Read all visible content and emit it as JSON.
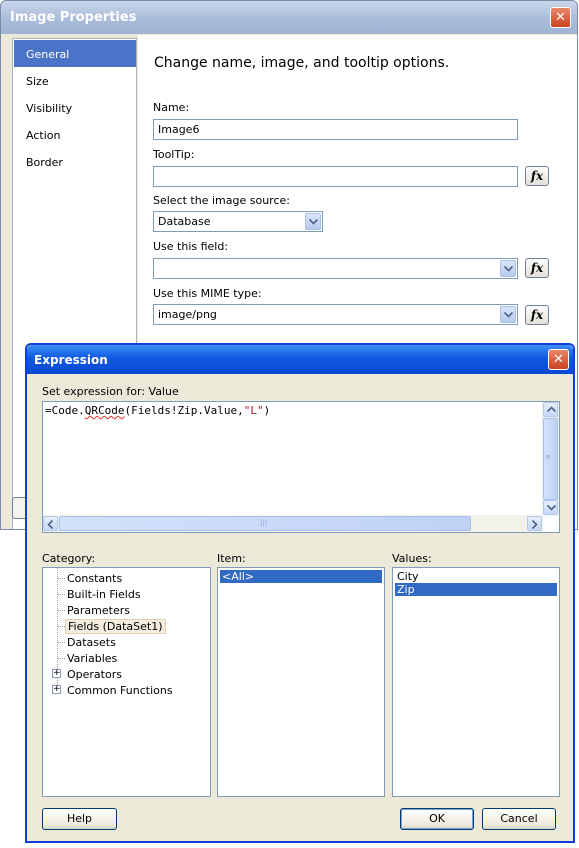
{
  "image_properties": {
    "title": "Image Properties",
    "close_glyph": "✕",
    "sidebar": [
      {
        "label": "General",
        "selected": true
      },
      {
        "label": "Size",
        "selected": false
      },
      {
        "label": "Visibility",
        "selected": false
      },
      {
        "label": "Action",
        "selected": false
      },
      {
        "label": "Border",
        "selected": false
      }
    ],
    "heading": "Change name, image, and tooltip options.",
    "name_label": "Name:",
    "name_value": "Image6",
    "tooltip_label": "ToolTip:",
    "tooltip_value": "",
    "source_label": "Select the image source:",
    "source_value": "Database",
    "field_label": "Use this field:",
    "field_value": "",
    "mime_label": "Use this MIME type:",
    "mime_value": "image/png",
    "fx_label": "fx"
  },
  "expression": {
    "title": "Expression",
    "close_glyph": "✕",
    "set_label": "Set expression for: Value",
    "code": {
      "prefix": "=Code.",
      "func": "QRCode",
      "middle": "(Fields!Zip.Value,",
      "string_arg": "\"L\"",
      "suffix": ")"
    },
    "category_label": "Category:",
    "categories": [
      {
        "label": "Constants",
        "expandable": false
      },
      {
        "label": "Built-in Fields",
        "expandable": false
      },
      {
        "label": "Parameters",
        "expandable": false
      },
      {
        "label": "Fields (DataSet1)",
        "expandable": false,
        "selected": true
      },
      {
        "label": "Datasets",
        "expandable": false
      },
      {
        "label": "Variables",
        "expandable": false
      },
      {
        "label": "Operators",
        "expandable": true
      },
      {
        "label": "Common Functions",
        "expandable": true
      }
    ],
    "expander_glyph": "+",
    "item_label": "Item:",
    "items": [
      {
        "label": "<All>",
        "selected": true
      }
    ],
    "values_label": "Values:",
    "values": [
      {
        "label": "City",
        "selected": false
      },
      {
        "label": "Zip",
        "selected": true
      }
    ],
    "buttons": {
      "help": "Help",
      "ok": "OK",
      "cancel": "Cancel"
    },
    "grip_glyph": "|||"
  }
}
